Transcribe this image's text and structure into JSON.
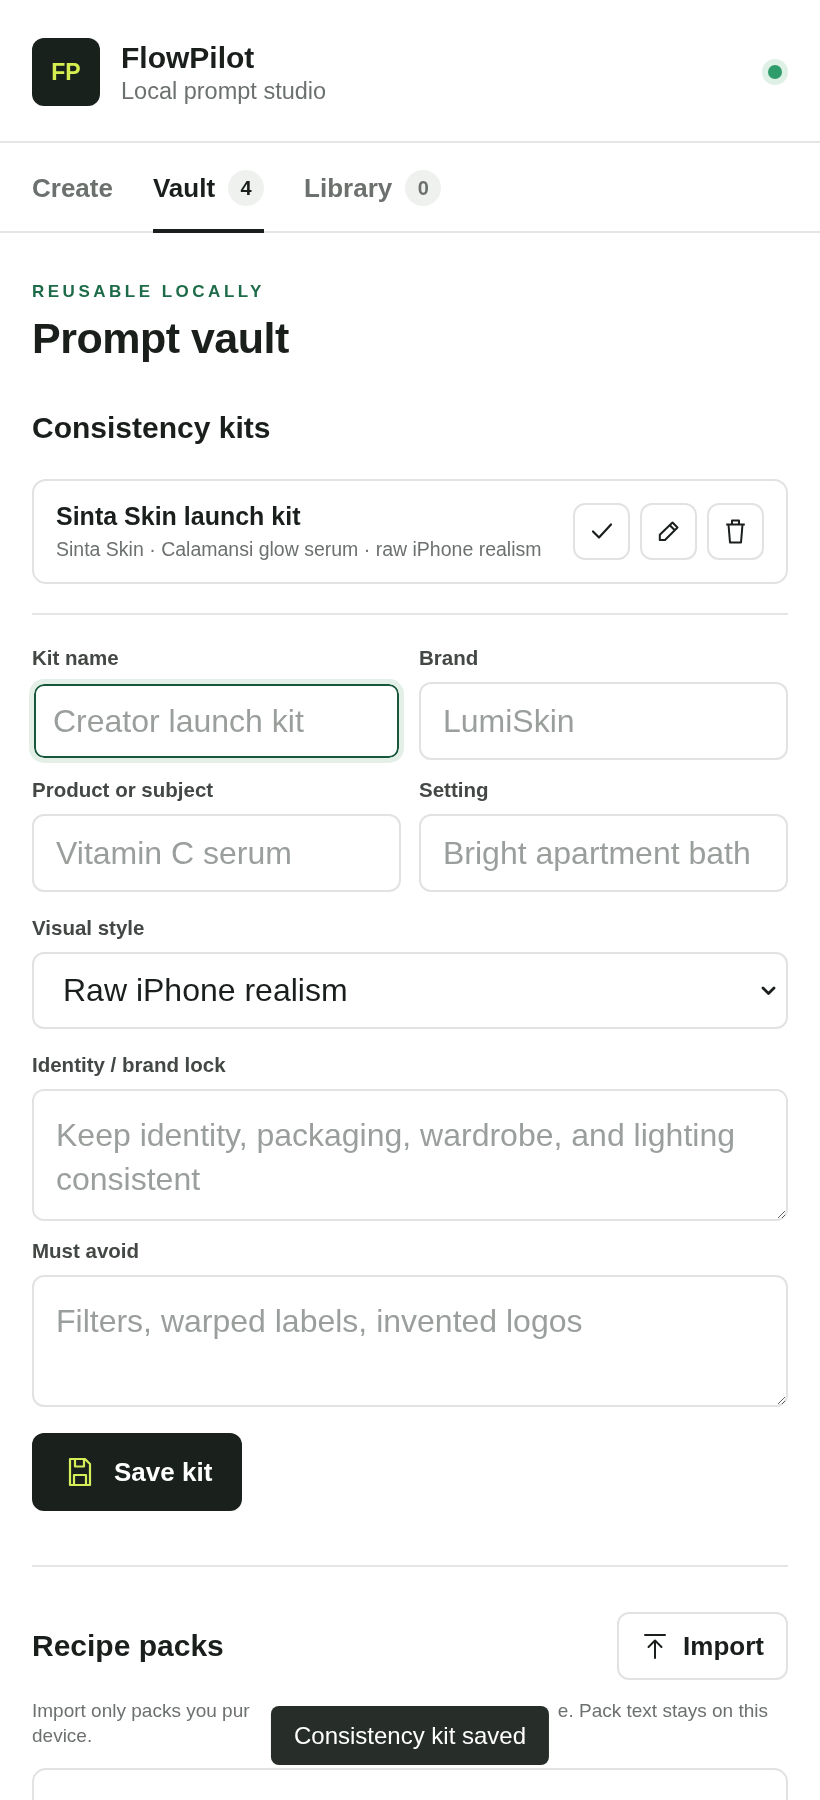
{
  "app": {
    "logo": "FP",
    "name": "FlowPilot",
    "subtitle": "Local prompt studio",
    "status_active": true
  },
  "tabs": [
    {
      "label": "Create",
      "selected": false
    },
    {
      "label": "Vault",
      "count": "4",
      "selected": true
    },
    {
      "label": "Library",
      "count": "0",
      "selected": false
    }
  ],
  "page": {
    "eyebrow": "REUSABLE LOCALLY",
    "title": "Prompt vault"
  },
  "kits_section": {
    "title": "Consistency kits",
    "kits": [
      {
        "name": "Sinta Skin launch kit",
        "details": "Sinta Skin · Calamansi glow serum · raw iPhone realism"
      }
    ]
  },
  "kit_form": {
    "fields": [
      {
        "kind": "input",
        "label": "Kit name",
        "placeholder": "Creator launch kit",
        "focused": true
      },
      {
        "kind": "input",
        "label": "Brand",
        "placeholder": "LumiSkin",
        "focused": false
      },
      {
        "kind": "input",
        "label": "Product or subject",
        "placeholder": "Vitamin C serum",
        "focused": false
      },
      {
        "kind": "input",
        "label": "Setting",
        "placeholder": "Bright apartment bath",
        "focused": false
      },
      {
        "kind": "select",
        "label": "Visual style",
        "value": "Raw iPhone realism",
        "focused": false
      },
      {
        "kind": "textarea",
        "label": "Identity / brand lock",
        "placeholder": "Keep identity, packaging, wardrobe, and lighting consistent",
        "focused": false
      },
      {
        "kind": "textarea",
        "label": "Must avoid",
        "placeholder": "Filters, warped labels, invented logos",
        "focused": false
      }
    ],
    "save_button": "Save kit"
  },
  "recipe_packs": {
    "title": "Recipe packs",
    "import_button": "Import",
    "note": {
      "line_1_start": "Import only packs you pur",
      "line_1_end": "e. Pack text stays on this",
      "line_2": "device."
    }
  },
  "toast": "Consistency kit saved"
}
